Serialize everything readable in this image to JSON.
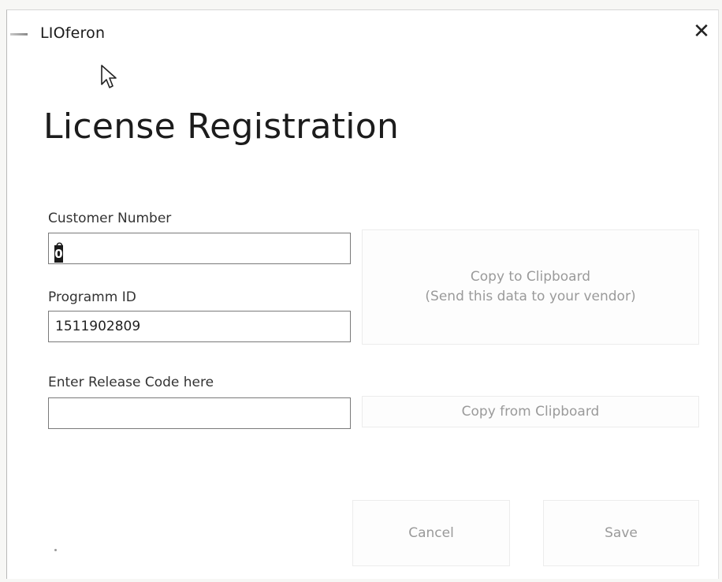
{
  "window": {
    "title": "LIOferon",
    "close_glyph": "✕"
  },
  "page": {
    "title": "License Registration"
  },
  "form": {
    "customer_number": {
      "label": "Customer Number",
      "value": "0"
    },
    "program_id": {
      "label": "Programm ID",
      "value": "1511902809"
    },
    "release_code": {
      "label": "Enter Release Code  here",
      "value": ""
    }
  },
  "buttons": {
    "copy_to_clipboard_line1": "Copy to Clipboard",
    "copy_to_clipboard_line2": "(Send this data to your vendor)",
    "copy_from_clipboard": "Copy from Clipboard",
    "cancel": "Cancel",
    "save": "Save"
  },
  "icons": {
    "app": "app-icon",
    "close": "close-icon",
    "cursor": "mouse-pointer-icon"
  }
}
